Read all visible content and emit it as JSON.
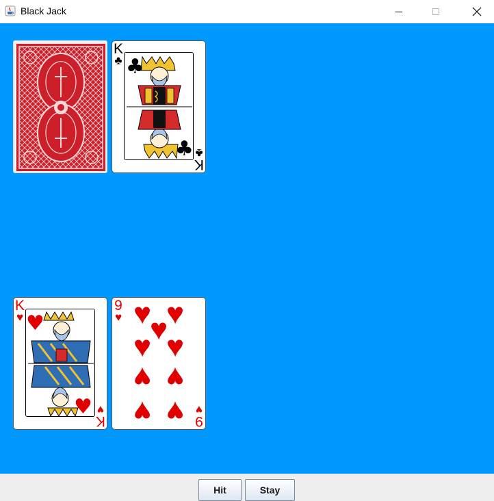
{
  "window": {
    "title": "Black Jack",
    "icons": {
      "app": "java-cup-icon",
      "minimize": "minimize-icon",
      "maximize": "maximize-icon",
      "close": "close-icon"
    }
  },
  "colors": {
    "table": "#0099ff",
    "card_red": "#e00000",
    "card_back": "#cc1f2a",
    "button_bar": "#eeeeee"
  },
  "dealer": {
    "cards": [
      {
        "face": "down",
        "design": "red card back"
      },
      {
        "rank": "K",
        "suit": "♣",
        "suit_name": "clubs"
      }
    ]
  },
  "player": {
    "cards": [
      {
        "rank": "K",
        "suit": "♥",
        "suit_name": "hearts"
      },
      {
        "rank": "9",
        "suit": "♥",
        "suit_name": "hearts"
      }
    ]
  },
  "buttons": {
    "hit": "Hit",
    "stay": "Stay"
  }
}
